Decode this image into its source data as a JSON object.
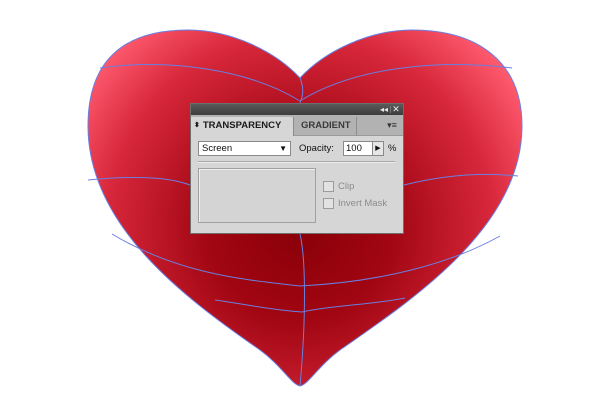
{
  "canvas": {
    "shape": "heart",
    "fill_colors": {
      "center": "#8a0008",
      "edge": "#ff5a6e"
    },
    "mesh_line_color": "#6a7fe0"
  },
  "panel": {
    "titlebar": {
      "collapse_icon": "double-left-arrow-icon",
      "close_icon": "close-icon",
      "collapse_glyph": "◂◂",
      "close_glyph": "✕"
    },
    "tabs": [
      {
        "label": "TRANSPARENCY",
        "active": true
      },
      {
        "label": "GRADIENT",
        "active": false
      }
    ],
    "tab_arrows_glyph": "⬍",
    "menu_glyph": "▾≡",
    "blend_mode": {
      "value": "Screen",
      "arrow_glyph": "▼"
    },
    "opacity": {
      "label": "Opacity:",
      "value": "100",
      "unit": "%",
      "stepper_glyph": "▶"
    },
    "options": {
      "clip": {
        "label": "Clip",
        "checked": false,
        "enabled": false
      },
      "invert_mask": {
        "label": "Invert Mask",
        "checked": false,
        "enabled": false
      }
    }
  }
}
